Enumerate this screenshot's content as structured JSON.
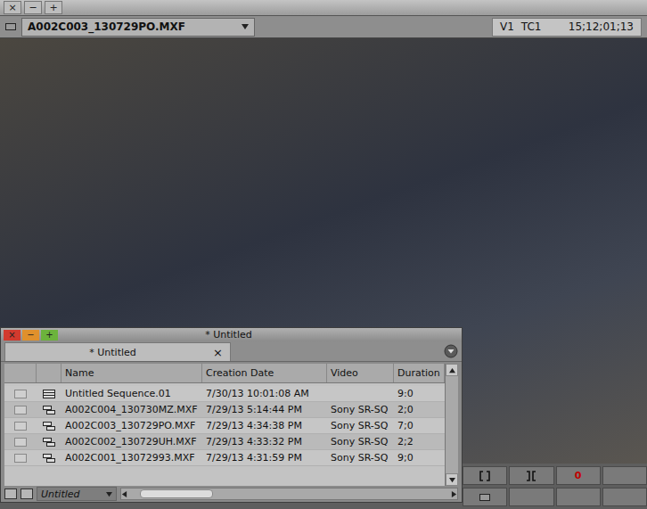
{
  "window": {
    "title_buttons": [
      "×",
      "−",
      "+"
    ]
  },
  "monitor": {
    "clip": "A002C003_130729PO.MXF",
    "track": "V1",
    "tc_label": "TC1",
    "timecode": "15;12;01;13"
  },
  "bin": {
    "title": "* Untitled",
    "title_buttons": [
      "×",
      "−",
      "+"
    ],
    "tab": {
      "label": "* Untitled",
      "close": "×"
    },
    "columns": [
      "Name",
      "Creation Date",
      "Video",
      "Duration"
    ],
    "rows": [
      {
        "kind": "sequence",
        "name": "Untitled Sequence.01",
        "created": "7/30/13 10:01:08 AM",
        "video": "",
        "duration": "9:0",
        "selected": false
      },
      {
        "kind": "clip",
        "name": "A002C004_130730MZ.MXF",
        "created": "7/29/13 5:14:44 PM",
        "video": "Sony SR-SQ",
        "duration": "2;0",
        "selected": false
      },
      {
        "kind": "clip",
        "name": "A002C003_130729PO.MXF",
        "created": "7/29/13 4:34:38 PM",
        "video": "Sony SR-SQ",
        "duration": "7;0",
        "selected": false
      },
      {
        "kind": "clip",
        "name": "A002C002_130729UH.MXF",
        "created": "7/29/13 4:33:32 PM",
        "video": "Sony SR-SQ",
        "duration": "2;2",
        "selected": false
      },
      {
        "kind": "clip",
        "name": "A002C001_13072993.MXF",
        "created": "7/29/13 4:31:59 PM",
        "video": "Sony SR-SQ",
        "duration": "9;0",
        "selected": false
      }
    ],
    "footer": {
      "view": "Untitled"
    }
  },
  "controls": {
    "counter": "0"
  }
}
